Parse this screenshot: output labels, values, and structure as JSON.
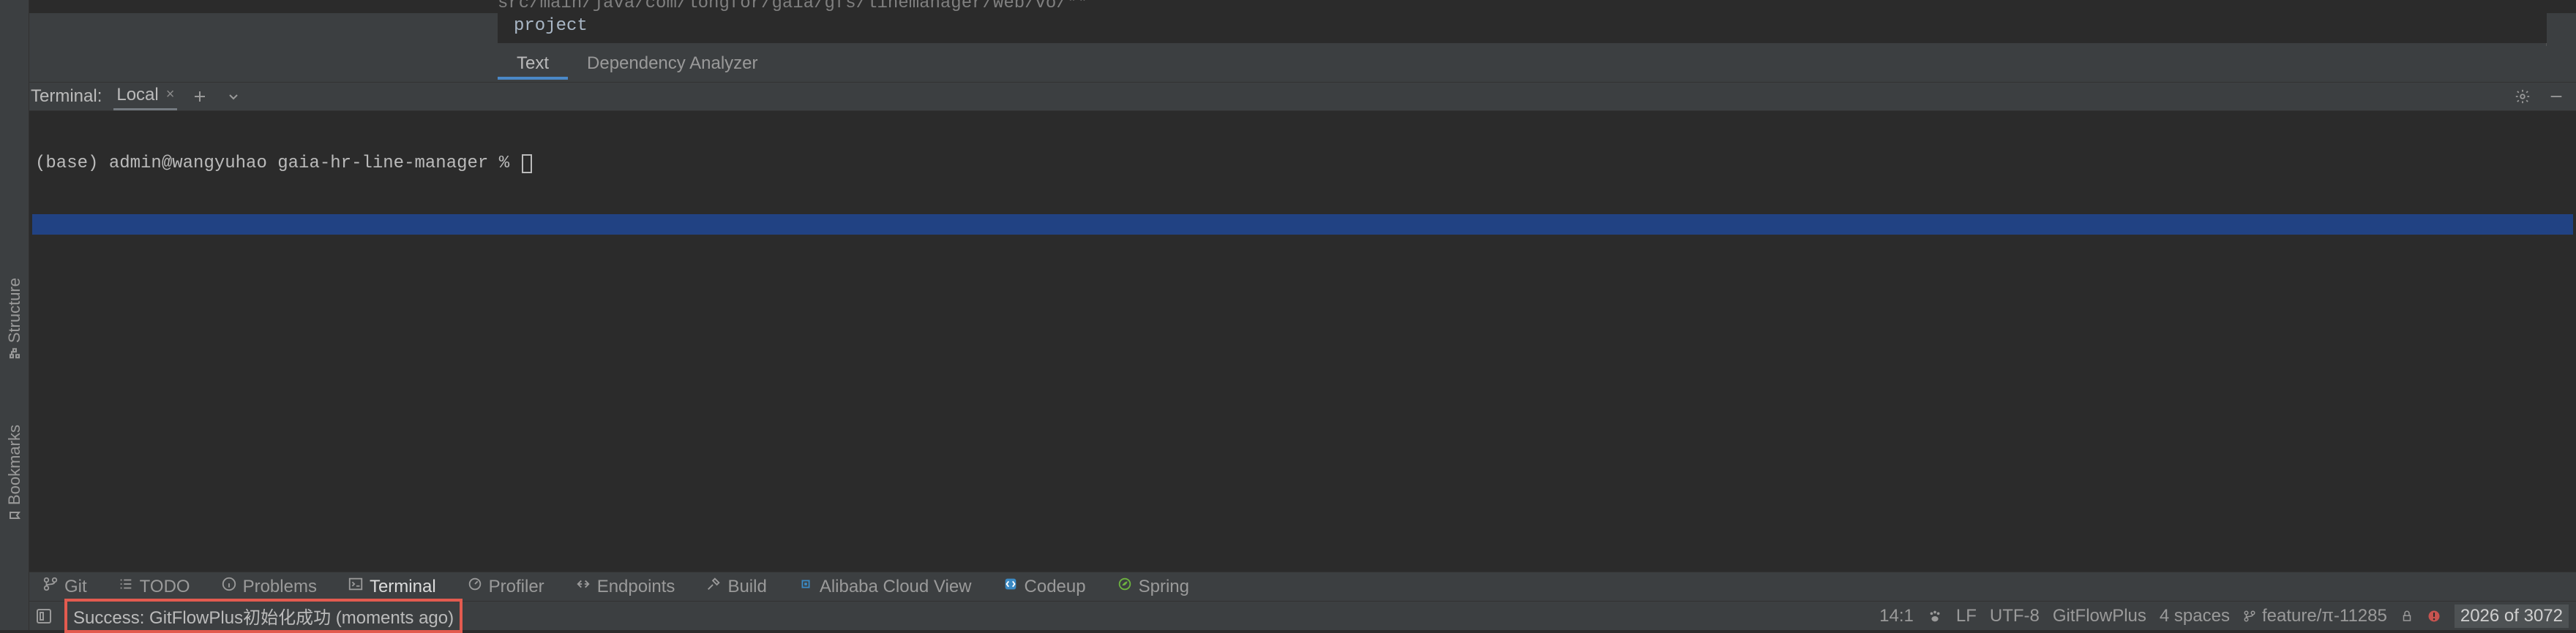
{
  "editor": {
    "code_line_partial": "src/main/java/com/longfor/gaia/gfs/linemanager/web/vo/**",
    "second_line": "project",
    "tabs": [
      {
        "label": "Text",
        "active": true
      },
      {
        "label": "Dependency Analyzer",
        "active": false
      }
    ]
  },
  "terminal": {
    "header_title": "Terminal:",
    "session_tab": "Local",
    "prompt": "(base) admin@wangyuhao gaia-hr-line-manager % "
  },
  "left_rail": {
    "structure": "Structure",
    "bookmarks": "Bookmarks"
  },
  "bottom_tabs": [
    {
      "label": "Git",
      "icon": "branch-icon",
      "active": false
    },
    {
      "label": "TODO",
      "icon": "list-icon",
      "active": false
    },
    {
      "label": "Problems",
      "icon": "info-icon",
      "active": false
    },
    {
      "label": "Terminal",
      "icon": "terminal-icon",
      "active": true
    },
    {
      "label": "Profiler",
      "icon": "profiler-icon",
      "active": false
    },
    {
      "label": "Endpoints",
      "icon": "endpoints-icon",
      "active": false
    },
    {
      "label": "Build",
      "icon": "hammer-icon",
      "active": false
    },
    {
      "label": "Alibaba Cloud View",
      "icon": "cloud-icon",
      "active": false,
      "color": "#3b8ac4"
    },
    {
      "label": "Codeup",
      "icon": "codeup-icon",
      "active": false,
      "color": "#3b8ac4"
    },
    {
      "label": "Spring",
      "icon": "spring-icon",
      "active": false,
      "color": "#6db33f"
    }
  ],
  "status_bar": {
    "success_msg": "Success: GitFlowPlus初始化成功 (moments ago)",
    "cursor_pos": "14:1",
    "line_sep": "LF",
    "encoding": "UTF-8",
    "plugin": "GitFlowPlus",
    "indent": "4 spaces",
    "branch": "feature/π-11285",
    "mem": "2026 of 3072"
  }
}
